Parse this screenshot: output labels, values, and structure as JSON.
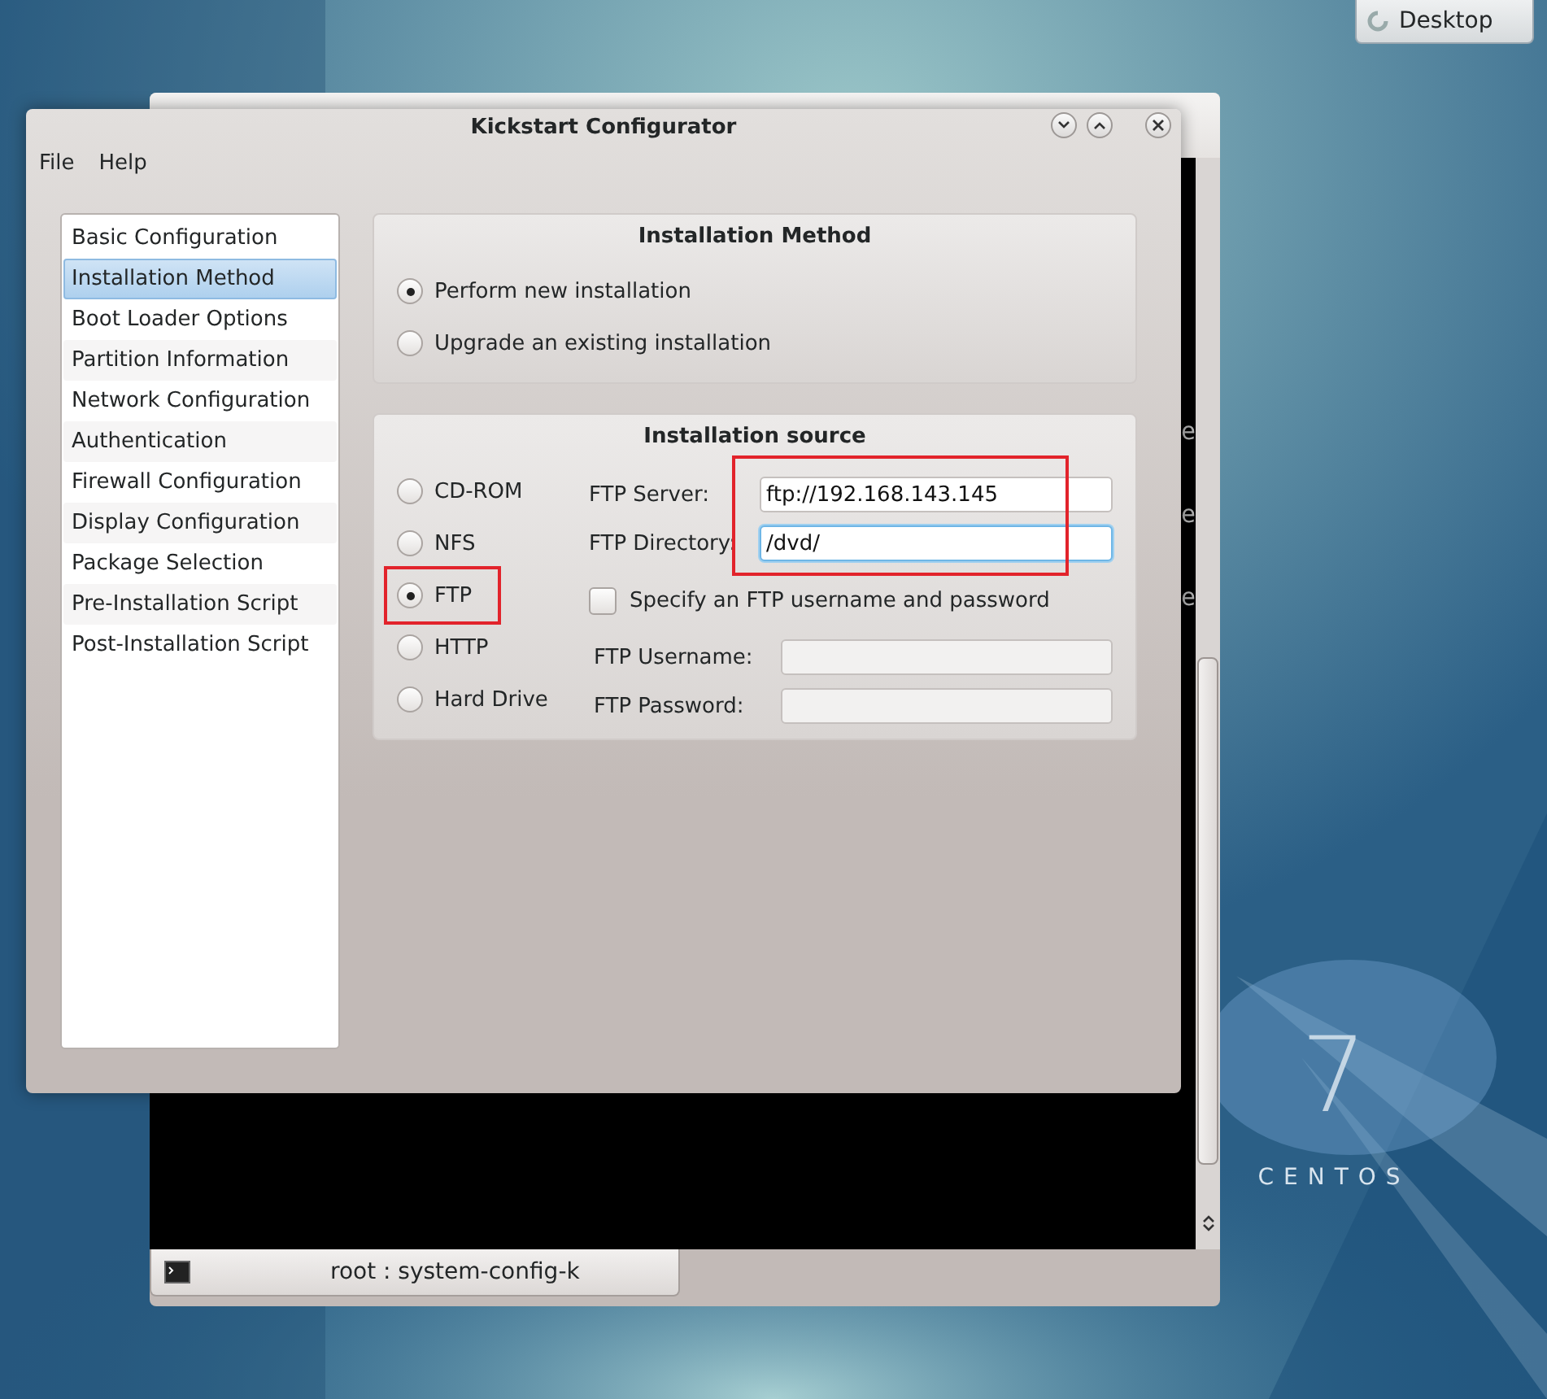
{
  "desktop_button": {
    "label": "Desktop"
  },
  "wallpaper": {
    "version": "7",
    "brand": "CENTOS"
  },
  "konsole": {
    "terminal_lines": [
      "e",
      "e",
      "e"
    ],
    "tabs": [
      {
        "label": "root : system-config-k",
        "selected": true
      }
    ]
  },
  "window": {
    "title": "Kickstart Configurator"
  },
  "menu": [
    "File",
    "Help"
  ],
  "sidebar": {
    "items": [
      {
        "label": "Basic Configuration",
        "selected": false
      },
      {
        "label": "Installation Method",
        "selected": true
      },
      {
        "label": "Boot Loader Options",
        "selected": false
      },
      {
        "label": "Partition Information",
        "selected": false
      },
      {
        "label": "Network Configuration",
        "selected": false
      },
      {
        "label": "Authentication",
        "selected": false
      },
      {
        "label": "Firewall Configuration",
        "selected": false
      },
      {
        "label": "Display Configuration",
        "selected": false
      },
      {
        "label": "Package Selection",
        "selected": false
      },
      {
        "label": "Pre-Installation Script",
        "selected": false
      },
      {
        "label": "Post-Installation Script",
        "selected": false
      }
    ]
  },
  "installation_method": {
    "title": "Installation Method",
    "options": [
      {
        "label": "Perform new installation",
        "selected": true
      },
      {
        "label": "Upgrade an existing installation",
        "selected": false
      }
    ]
  },
  "installation_source": {
    "title": "Installation source",
    "options": [
      {
        "label": "CD-ROM",
        "selected": false,
        "highlighted": false
      },
      {
        "label": "NFS",
        "selected": false,
        "highlighted": false
      },
      {
        "label": "FTP",
        "selected": true,
        "highlighted": true
      },
      {
        "label": "HTTP",
        "selected": false,
        "highlighted": false
      },
      {
        "label": "Hard Drive",
        "selected": false,
        "highlighted": false
      }
    ],
    "server_fields_highlighted": true,
    "server_fields": [
      {
        "label": "FTP Server:",
        "value": "ftp://192.168.143.145",
        "focused": false
      },
      {
        "label": "FTP Directory:",
        "value": "/dvd/",
        "focused": true
      }
    ],
    "credentials_checkbox": {
      "label": "Specify an FTP username and password",
      "checked": false
    },
    "credential_fields": [
      {
        "label": "FTP Username:",
        "disabled": true
      },
      {
        "label": "FTP Password:",
        "disabled": true
      }
    ]
  }
}
